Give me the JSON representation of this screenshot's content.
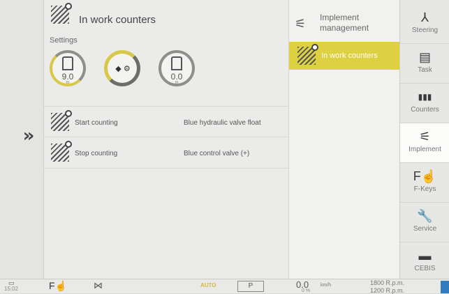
{
  "main": {
    "title": "In work counters",
    "settings_label": "Settings",
    "dials": [
      {
        "value": "9.0",
        "unit": "m"
      },
      {
        "value": "",
        "unit": ""
      },
      {
        "value": "0.0",
        "unit": "m"
      }
    ],
    "rows": [
      {
        "label": "Start counting",
        "value": "Blue hydraulic valve float"
      },
      {
        "label": "Stop counting",
        "value": "Blue control valve (+)"
      }
    ]
  },
  "middle": {
    "items": [
      {
        "label": "Implement management",
        "icon": "implement-icon"
      },
      {
        "label": "In work counters",
        "icon": "hatch-icon"
      }
    ]
  },
  "nav": {
    "items": [
      {
        "label": "Steering",
        "icon": "steering-icon"
      },
      {
        "label": "Task",
        "icon": "task-icon"
      },
      {
        "label": "Counters",
        "icon": "counters-icon"
      },
      {
        "label": "Implement",
        "icon": "implement-icon"
      },
      {
        "label": "F-Keys",
        "icon": "fkeys-icon"
      },
      {
        "label": "Service",
        "icon": "wrench-icon"
      },
      {
        "label": "CEBIS",
        "icon": "monitor-icon"
      }
    ]
  },
  "bottom": {
    "time": "15:02",
    "auto": "AUTO",
    "park": "P",
    "speed": "0.0",
    "speed_unit": "km/h",
    "percent": "0 %",
    "rpm1": "1800 R.p.m.",
    "rpm2": "1200 R.p.m."
  },
  "colors": {
    "accent": "#ddd041",
    "blue": "#2f7bbd"
  }
}
